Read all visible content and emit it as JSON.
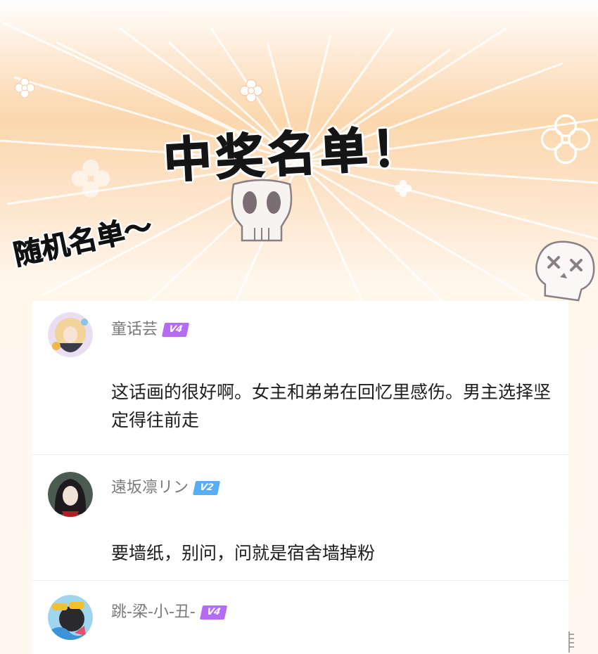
{
  "header": {
    "title": "中奖名单！",
    "subtitle": "随机名单～"
  },
  "colors": {
    "badge_v4": "#b46cf0",
    "badge_v2": "#58aef5",
    "username": "#7a7a7a",
    "comment_text": "#1e1e1e",
    "background_orange": "#fbd7ad"
  },
  "comments": [
    {
      "username": "童话芸",
      "badge": "V4",
      "avatar_icon": "anime-girl-avatar-icon",
      "text": "这话画的很好啊。女主和弟弟在回忆里感伤。男主选择坚定得往前走"
    },
    {
      "username": "遠坂凛リン",
      "badge": "V2",
      "avatar_icon": "dark-hair-girl-avatar-icon",
      "text": "要墙纸，别问，问就是宿舍墙掉粉"
    },
    {
      "username": "跳-梁-小-丑-",
      "badge": "V4",
      "avatar_icon": "sunglasses-avatar-icon",
      "text": ""
    }
  ],
  "decorations": [
    "skull-icon",
    "skull-cross-eyes-icon",
    "flower-icon"
  ]
}
